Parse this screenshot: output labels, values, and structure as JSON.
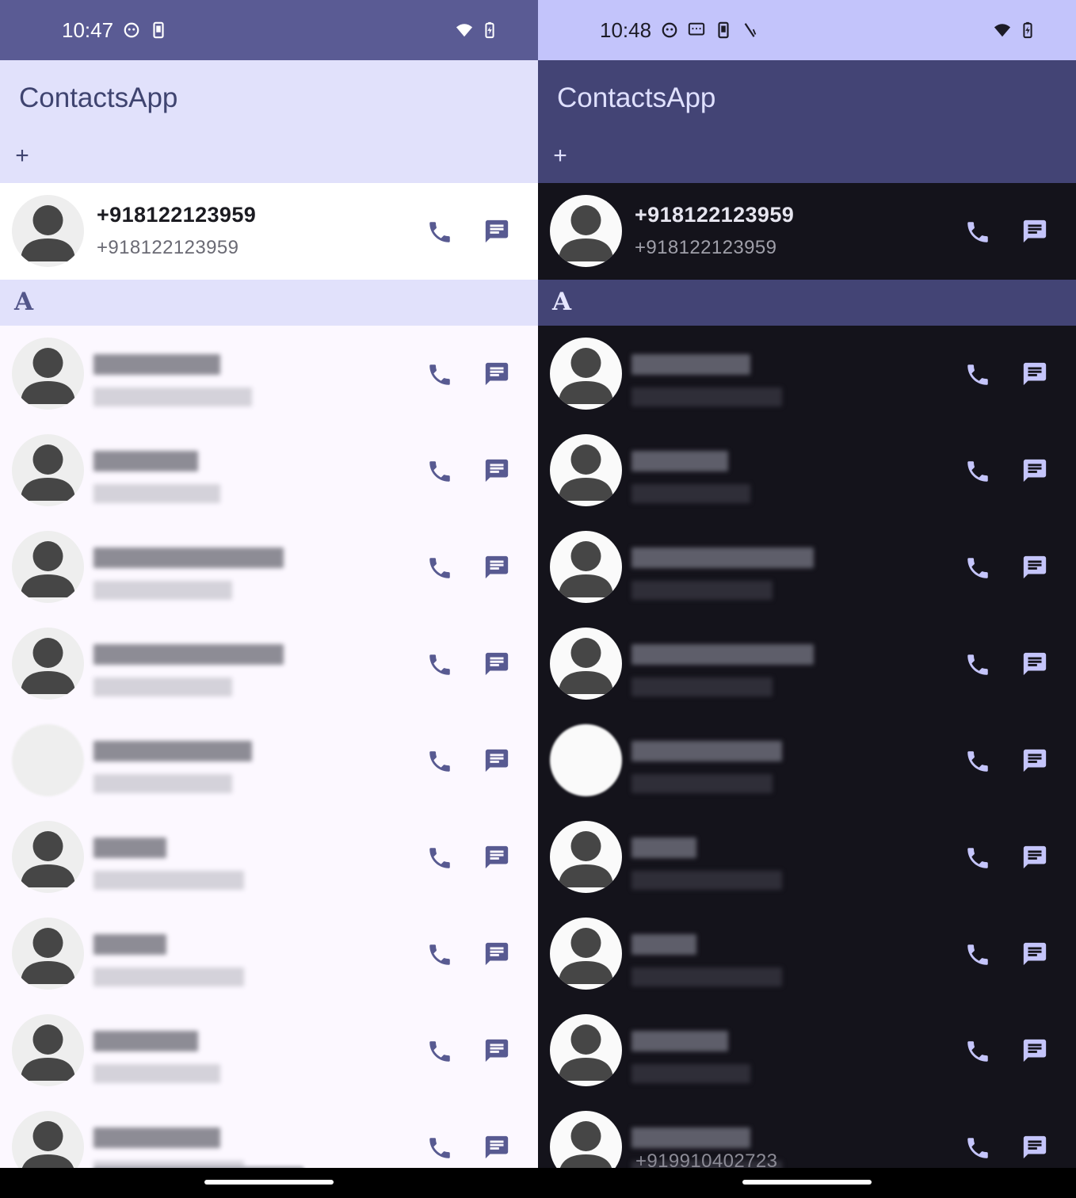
{
  "left": {
    "status_time": "10:47",
    "app_title": "ContactsApp",
    "add_label": "+",
    "pinned": {
      "name": "+918122123959",
      "number": "+918122123959"
    },
    "section_letter": "A"
  },
  "right": {
    "status_time": "10:48",
    "app_title": "ContactsApp",
    "add_label": "+",
    "pinned": {
      "name": "+918122123959",
      "number": "+918122123959"
    },
    "section_letter": "A",
    "partial_number": "+919910402723"
  },
  "icons": {
    "call": "phone-icon",
    "message": "message-icon",
    "avatar": "person-placeholder-icon",
    "wifi": "wifi-icon",
    "battery": "battery-charging-icon"
  },
  "colors": {
    "light_status": "#5a5b94",
    "light_appbar": "#e1e1fb",
    "dark_status": "#c3c4fb",
    "dark_appbar": "#434475",
    "light_accent": "#585a91",
    "dark_accent": "#c5c5fb"
  }
}
